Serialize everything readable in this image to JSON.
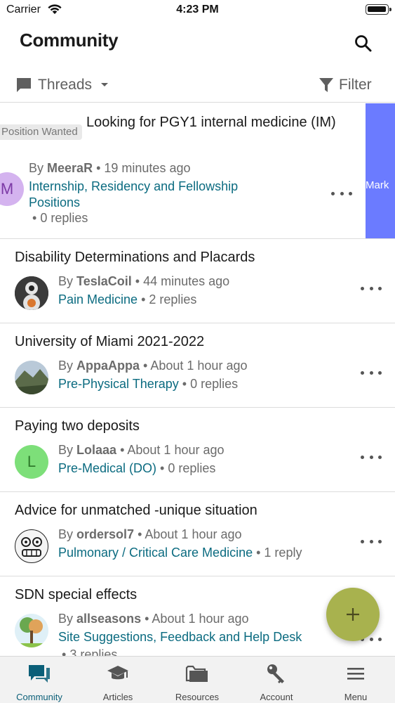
{
  "status_bar": {
    "carrier": "Carrier",
    "time": "4:23 PM"
  },
  "header": {
    "title": "Community",
    "search_icon": "search-icon"
  },
  "toolbar": {
    "view_label": "Threads",
    "view_icon": "chat-bubble-icon",
    "filter_label": "Filter",
    "filter_icon": "funnel-icon"
  },
  "threads": [
    {
      "tag": "Position Wanted",
      "title": "Looking for PGY1 internal medicine (IM)",
      "by": "By",
      "author": "MeeraR",
      "time": "19 minutes ago",
      "forum": "Internship, Residency and Fellowship Positions",
      "replies": "0 replies",
      "avatar_letter": "M",
      "avatar_color": "#d4b3ef",
      "swipe_action": "Mark"
    },
    {
      "title": "Disability Determinations and Placards",
      "by": "By",
      "author": "TeslaCoil",
      "time": "44 minutes ago",
      "forum": "Pain Medicine",
      "replies": "2 replies"
    },
    {
      "title": "University of Miami 2021-2022",
      "by": "By",
      "author": "AppaAppa",
      "time": "About 1 hour ago",
      "forum": "Pre-Physical Therapy",
      "replies": "0 replies"
    },
    {
      "title": "Paying two deposits",
      "by": "By",
      "author": "Lolaaa",
      "time": "About 1 hour ago",
      "forum": "Pre-Medical (DO)",
      "replies": "0 replies",
      "avatar_letter": "L",
      "avatar_color": "#7ddf79"
    },
    {
      "title": "Advice for unmatched -unique situation",
      "by": "By",
      "author": "ordersol7",
      "time": "About 1 hour ago",
      "forum": "Pulmonary / Critical Care Medicine",
      "replies": "1 reply"
    },
    {
      "title": "SDN special effects",
      "by": "By",
      "author": "allseasons",
      "time": "About 1 hour ago",
      "forum": "Site Suggestions, Feedback and Help Desk",
      "replies": "3 replies"
    }
  ],
  "fab": {
    "icon": "plus-icon"
  },
  "tabbar": {
    "tabs": [
      {
        "label": "Community",
        "icon": "chat-bubbles-icon",
        "active": true
      },
      {
        "label": "Articles",
        "icon": "graduation-cap-icon",
        "active": false
      },
      {
        "label": "Resources",
        "icon": "folder-icon",
        "active": false
      },
      {
        "label": "Account",
        "icon": "key-icon",
        "active": false
      },
      {
        "label": "Menu",
        "icon": "hamburger-icon",
        "active": false
      }
    ]
  },
  "colors": {
    "accent": "#0b6b80",
    "fab": "#a8b24e",
    "swipe": "#6b7bff",
    "active_tab": "#0b5f78"
  }
}
